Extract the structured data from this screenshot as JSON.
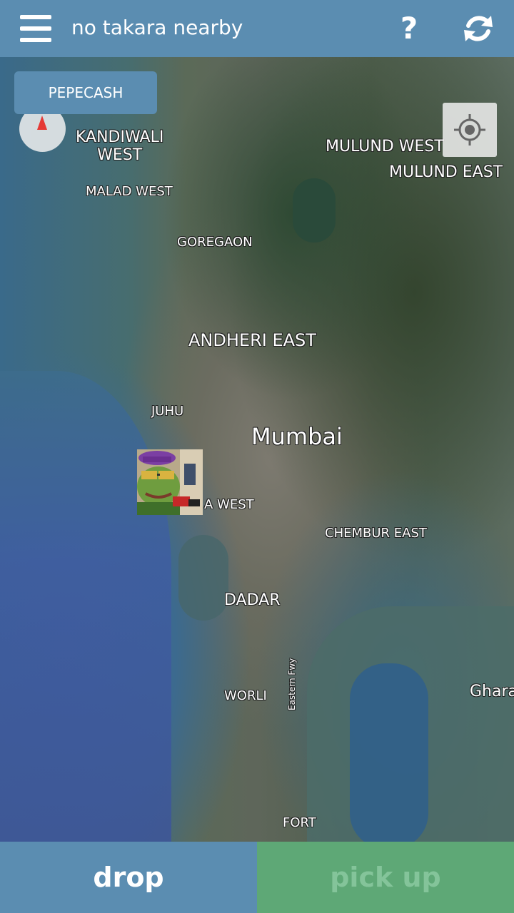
{
  "app_bar": {
    "title": "no takara nearby",
    "menu_icon": "hamburger-menu-icon",
    "help_icon": "question-mark-icon",
    "help_glyph": "?",
    "refresh_icon": "refresh-icon",
    "background_color": "#5b8db1"
  },
  "map": {
    "pepecash_button": "PEPECASH",
    "compass_icon": "compass-icon",
    "locate_icon": "my-location-icon",
    "marker_icon": "pepe-avatar-icon",
    "labels": {
      "kandiwali_west_line1": "KANDIWALI",
      "kandiwali_west_line2": "WEST",
      "mulund_west": "MULUND WEST",
      "mulund_east": "MULUND EAST",
      "malad_west": "MALAD WEST",
      "goregaon": "GOREGAON",
      "andheri_east": "ANDHERI EAST",
      "juhu": "JUHU",
      "mumbai": "Mumbai",
      "bandra_west_partial": "A WEST",
      "chembur_east": "CHEMBUR EAST",
      "dadar": "DADAR",
      "worli": "WORLI",
      "eastern_fwy": "Eastern Fwy",
      "gharapuri_partial": "Ghara",
      "fort": "FORT"
    }
  },
  "bottom_bar": {
    "drop_label": "drop",
    "pickup_label": "pick up",
    "drop_color": "#5b8db1",
    "pickup_color": "#5ea876"
  }
}
